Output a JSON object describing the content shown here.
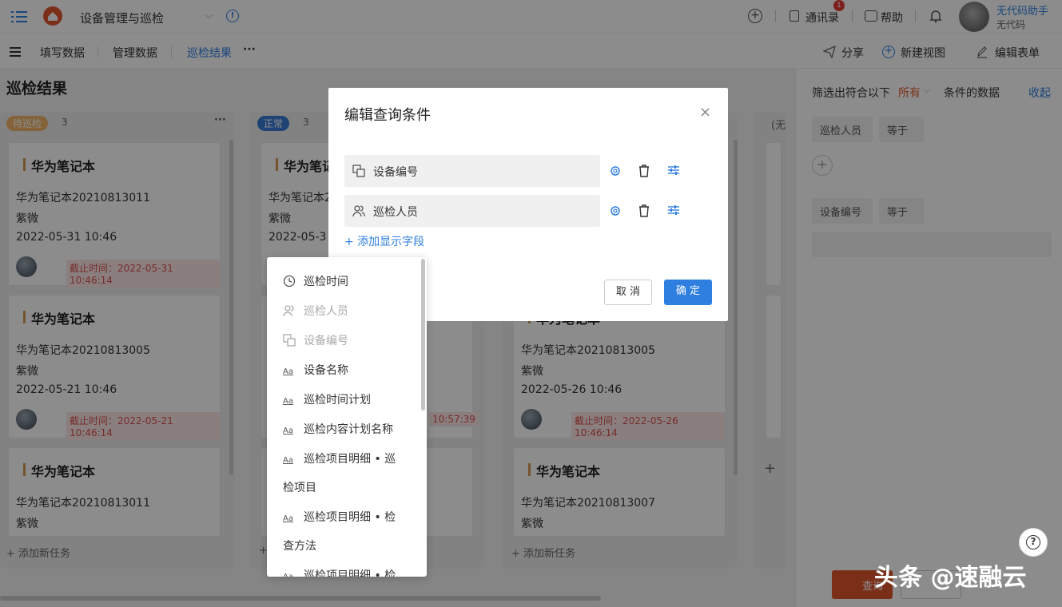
{
  "topbar": {
    "app_title": "设备管理与巡检",
    "contacts": "通讯录",
    "contacts_badge": "1",
    "help": "帮助",
    "user_name": "无代码助手",
    "user_org": "无代码"
  },
  "subbar": {
    "tabs": [
      "填写数据",
      "管理数据",
      "巡检结果"
    ],
    "more": "···",
    "share": "分享",
    "new_view": "新建视图",
    "edit_form": "编辑表单"
  },
  "page_title": "巡检结果",
  "columns": [
    {
      "label": "待巡检",
      "count": "3",
      "more": "···"
    },
    {
      "label": "正常",
      "count": "3"
    },
    {
      "label": "(无",
      "count": ""
    }
  ],
  "cards_col1": [
    {
      "title": "华为笔记本",
      "code": "华为笔记本20210813011",
      "person": "紫微",
      "time": "2022-05-31 10:46",
      "deadline": "截止时间：2022-05-31 10:46:14"
    },
    {
      "title": "华为笔记本",
      "code": "华为笔记本20210813005",
      "person": "紫微",
      "time": "2022-05-21 10:46",
      "deadline": "截止时间：2022-05-21 10:46:14"
    },
    {
      "title": "华为笔记本",
      "code": "华为笔记本20210813011",
      "person": "紫微"
    }
  ],
  "cards_col2": [
    {
      "title": "华为笔记",
      "code": "华为笔记本2",
      "person": "紫微",
      "time": "2022-05-3"
    },
    {
      "deadline": "10:57:39"
    }
  ],
  "cards_col3": [
    {
      "title": "华为笔记本",
      "code": "华为笔记本20210813005",
      "person": "紫微",
      "time": "2022-05-26 10:46",
      "deadline": "截止时间：2022-05-26 10:46:14"
    },
    {
      "title": "华为笔记本",
      "code": "华为笔记本20210813007",
      "person": "紫微"
    }
  ],
  "add_task": "添加新任务",
  "right_panel": {
    "filter_prefix": "筛选出符合以下",
    "filter_mode": "所有",
    "filter_suffix": "条件的数据",
    "collapse": "收起",
    "cond1_field": "巡检人员",
    "cond1_op": "等于",
    "cond2_field": "设备编号",
    "cond2_op": "等于",
    "query_button": "查询"
  },
  "modal": {
    "title": "编辑查询条件",
    "fields": [
      "设备编号",
      "巡检人员"
    ],
    "add_field": "添加显示字段",
    "cancel": "取 消",
    "confirm": "确 定"
  },
  "dropdown": {
    "items": [
      {
        "label": "巡检时间",
        "icon": "clock-icon",
        "disabled": false
      },
      {
        "label": "巡检人员",
        "icon": "user-icon",
        "disabled": true
      },
      {
        "label": "设备编号",
        "icon": "link-icon",
        "disabled": true
      },
      {
        "label": "设备名称",
        "icon": "text-icon",
        "disabled": false
      },
      {
        "label": "巡检时间计划",
        "icon": "text-icon",
        "disabled": false
      },
      {
        "label": "巡检内容计划名称",
        "icon": "text-icon",
        "disabled": false
      },
      {
        "label": "巡检项目明细 • 巡",
        "label2": "检项目",
        "icon": "text-icon",
        "disabled": false
      },
      {
        "label": "巡检项目明细 • 检",
        "label2": "查方法",
        "icon": "text-icon",
        "disabled": false
      },
      {
        "label": "巡检项目明细 • 检",
        "icon": "text-icon",
        "disabled": false
      }
    ],
    "text_icon_glyph": "Aa"
  },
  "watermark": "头条 @速融云",
  "colors": {
    "accent": "#2f7fe0",
    "danger": "#d9534f",
    "status_pending": "#f0b56a"
  }
}
